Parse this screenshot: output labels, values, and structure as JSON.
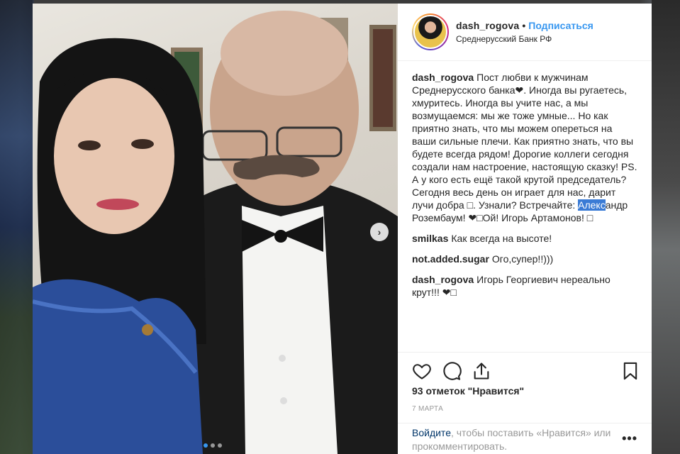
{
  "post": {
    "username": "dash_rogova",
    "separator": "•",
    "follow_label": "Подписаться",
    "location": "Среднерусский Банк РФ",
    "next_arrow": "›"
  },
  "comments": [
    {
      "user": "dash_rogova",
      "text_before": "Пост любви к мужчинам Среднерусского банка❤. Иногда вы ругаетесь, хмуритесь. Иногда вы учите нас, а мы возмущаемся: мы же тоже умные... Но как приятно знать, что мы можем опереться на ваши сильные плечи. Как приятно знать, что вы будете всегда рядом! Дорогие коллеги сегодня создали нам настроение, настоящую сказку! PS. А у кого есть ещё такой крутой председатель? Сегодня весь день он играет для нас, дарит лучи добра □. Узнали? Встречайте: ",
      "highlight": "Алекс",
      "text_after": "андр Розембаум! ❤□Ой! Игорь Артамонов! □"
    },
    {
      "user": "smilkas",
      "text": "Как всегда на высоте!"
    },
    {
      "user": "not.added.sugar",
      "text": "Ого,супер!!)))"
    },
    {
      "user": "dash_rogova",
      "text": "Игорь Георгиевич нереально крут!!! ❤□"
    }
  ],
  "actions": {
    "icons": [
      "heart-icon",
      "comment-icon",
      "share-icon",
      "bookmark-icon"
    ]
  },
  "likes_label": "93 отметок \"Нравится\"",
  "date": "7 МАРТА",
  "login": {
    "link": "Войдите",
    "text": ", чтобы поставить «Нравится» или прокомментировать.",
    "more": "•••"
  },
  "carousel": {
    "slides": 3,
    "active_index": 0
  },
  "colors": {
    "accent": "#3897f0",
    "text": "#262626",
    "muted": "#999999",
    "highlight": "#3a7bd5"
  }
}
